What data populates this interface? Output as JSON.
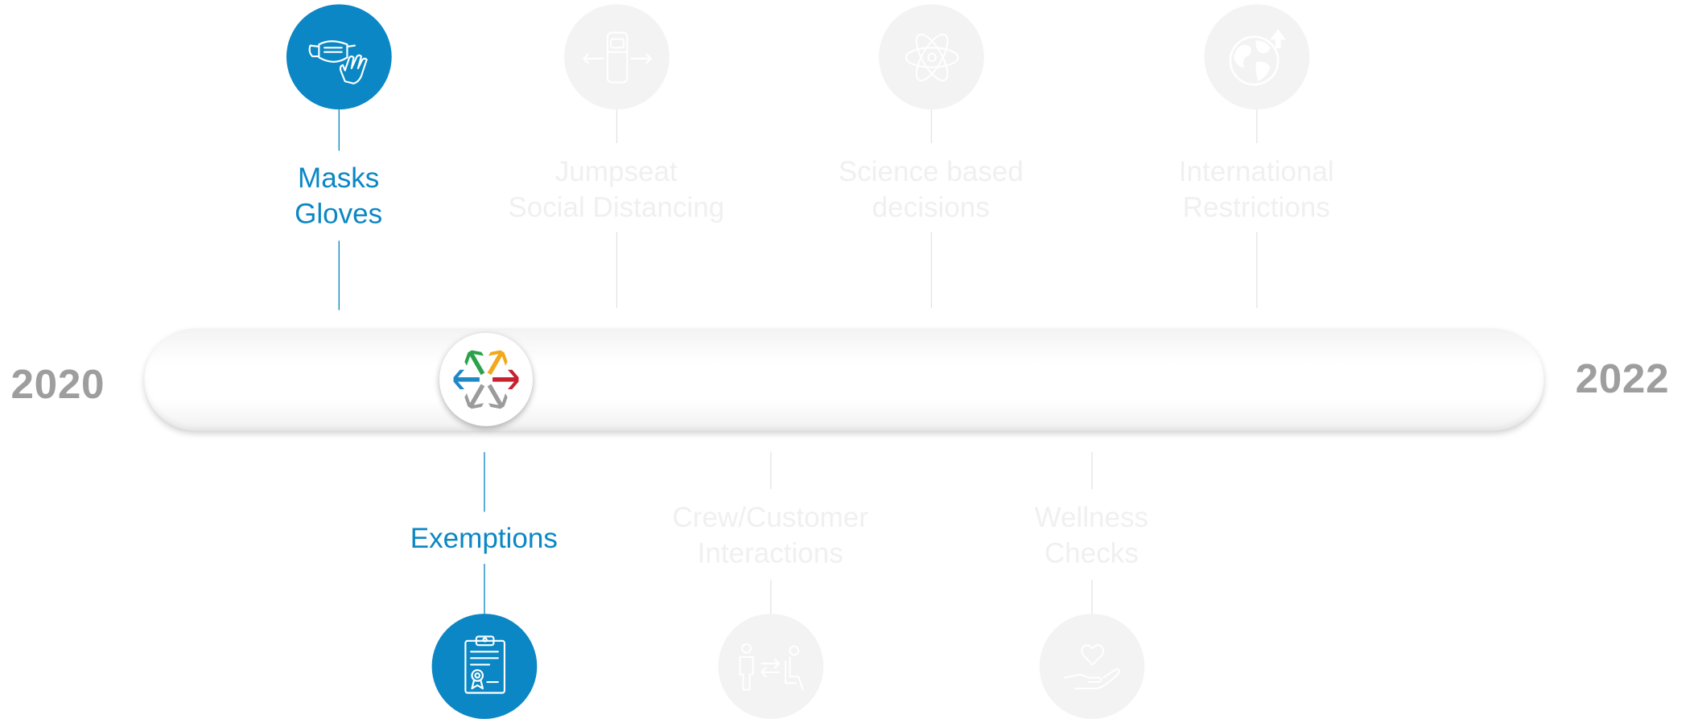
{
  "timeline": {
    "start_year": "2020",
    "end_year": "2022"
  },
  "milestones_top": [
    {
      "lines": [
        "Masks",
        "Gloves"
      ],
      "icon": "mask-glove-icon",
      "state": "active"
    },
    {
      "lines": [
        "Jumpseat",
        "Social Distancing"
      ],
      "icon": "jumpseat-icon",
      "state": "inactive"
    },
    {
      "lines": [
        "Science based",
        "decisions"
      ],
      "icon": "atom-icon",
      "state": "inactive"
    },
    {
      "lines": [
        "International",
        "Restrictions"
      ],
      "icon": "globe-icon",
      "state": "inactive"
    }
  ],
  "milestones_bottom": [
    {
      "lines": [
        "Exemptions"
      ],
      "icon": "clipboard-certificate-icon",
      "state": "active"
    },
    {
      "lines": [
        "Crew/Customer",
        "Interactions"
      ],
      "icon": "crew-customer-icon",
      "state": "inactive"
    },
    {
      "lines": [
        "Wellness",
        "Checks"
      ],
      "icon": "heart-hand-icon",
      "state": "inactive"
    }
  ],
  "colors": {
    "active": "#0a87c4",
    "inactive_circle": "#f3f3f3",
    "inactive_text": "#f0f0f0",
    "year": "#9e9e9e",
    "logo": [
      "#2aa24a",
      "#f3a81a",
      "#c8202f",
      "#9b9b9b",
      "#1e88c7"
    ]
  },
  "logo_icon": "airline-snowflake-logo-icon"
}
